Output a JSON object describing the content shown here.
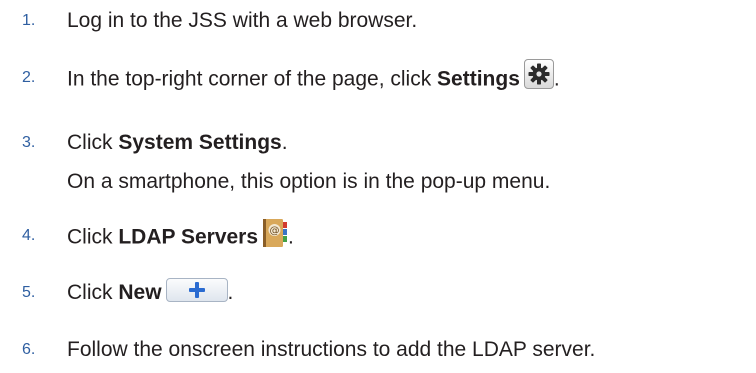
{
  "steps": [
    {
      "number": "1.",
      "text": "Log in to the JSS with a web browser."
    },
    {
      "number": "2.",
      "prefix": "In the top-right corner of the page, click ",
      "bold": "Settings",
      "suffix": ".",
      "icon": "gear-icon"
    },
    {
      "number": "3.",
      "prefix": "Click ",
      "bold": "System Settings",
      "suffix": ".",
      "note": "On a smartphone, this option is in the pop-up menu."
    },
    {
      "number": "4.",
      "prefix": "Click ",
      "bold": "LDAP Servers",
      "suffix": ".",
      "icon": "address-book-icon"
    },
    {
      "number": "5.",
      "prefix": "Click ",
      "bold": "New",
      "suffix": ".",
      "icon": "plus-icon"
    },
    {
      "number": "6.",
      "text": "Follow the onscreen instructions to add the LDAP server."
    }
  ],
  "colors": {
    "number": "#2f5fa1",
    "text": "#231f20",
    "plus": "#2a6bd1"
  }
}
